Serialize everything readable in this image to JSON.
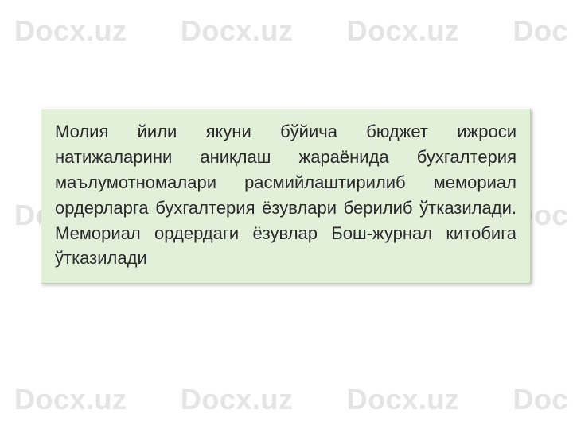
{
  "watermark": {
    "text": "Docx.uz",
    "partial": "Doc"
  },
  "content": {
    "paragraph": "Молия йили якуни бўйича бюджет ижроси натижаларини аниқлаш жараёнида бухгалтерия маълумотномалари расмийлаштирилиб мемориал ордерларга бухгалтерия ёзувлари берилиб ўтказилади. Мемориал ордердаги ёзувлар Бош-журнал китобига ўтказилади"
  }
}
